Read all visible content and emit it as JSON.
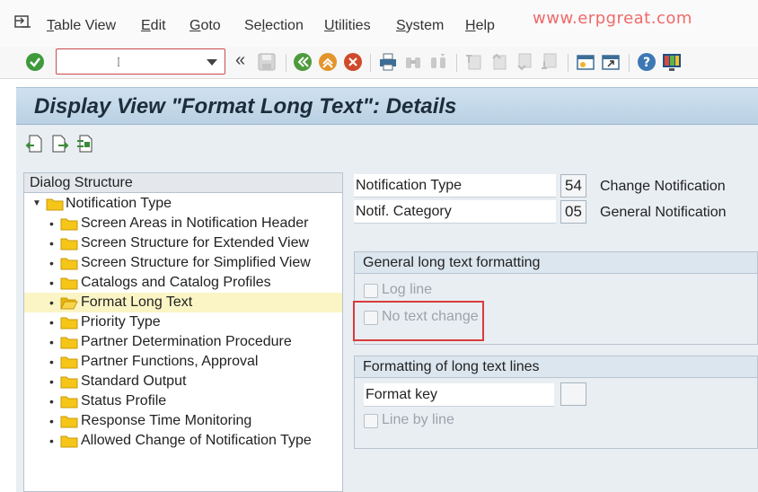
{
  "menu": {
    "items": [
      {
        "acc": "T",
        "rest": "able View"
      },
      {
        "acc": "E",
        "rest": "dit"
      },
      {
        "acc": "G",
        "rest": "oto"
      },
      {
        "pre": "Se",
        "acc": "l",
        "rest": "ection"
      },
      {
        "acc": "U",
        "rest": "tilities"
      },
      {
        "acc": "S",
        "rest": "ystem"
      },
      {
        "acc": "H",
        "rest": "elp"
      }
    ]
  },
  "watermark": "www.erpgreat.com",
  "toolbar": {
    "command_value": "",
    "back_symbol": "«"
  },
  "title": "Display View \"Format Long Text\": Details",
  "dialog_structure": {
    "header": "Dialog Structure",
    "root": "Notification Type",
    "items": [
      "Screen Areas in Notification Header",
      "Screen Structure for Extended View",
      "Screen Structure for Simplified View",
      "Catalogs and Catalog Profiles",
      "Format Long Text",
      "Priority Type",
      "Partner Determination Procedure",
      "Partner Functions, Approval",
      "Standard Output",
      "Status Profile",
      "Response Time Monitoring",
      "Allowed Change of Notification Type"
    ],
    "selected_index": 4
  },
  "fields": {
    "notif_type": {
      "label": "Notification Type",
      "value": "54",
      "desc": "Change Notification"
    },
    "notif_cat": {
      "label": "Notif. Category",
      "value": "05",
      "desc": "General Notification"
    }
  },
  "general_group": {
    "title": "General long text formatting",
    "log_line": "Log line",
    "no_text_change": "No text change"
  },
  "lines_group": {
    "title": "Formatting of long text lines",
    "format_key_label": "Format key",
    "format_key_value": "",
    "line_by_line": "Line by line"
  },
  "colors": {
    "title_bg": "#c4d9ea",
    "highlight": "#d83c3c",
    "selected_row": "#fbf5c5",
    "watermark": "#ee6a6a"
  }
}
